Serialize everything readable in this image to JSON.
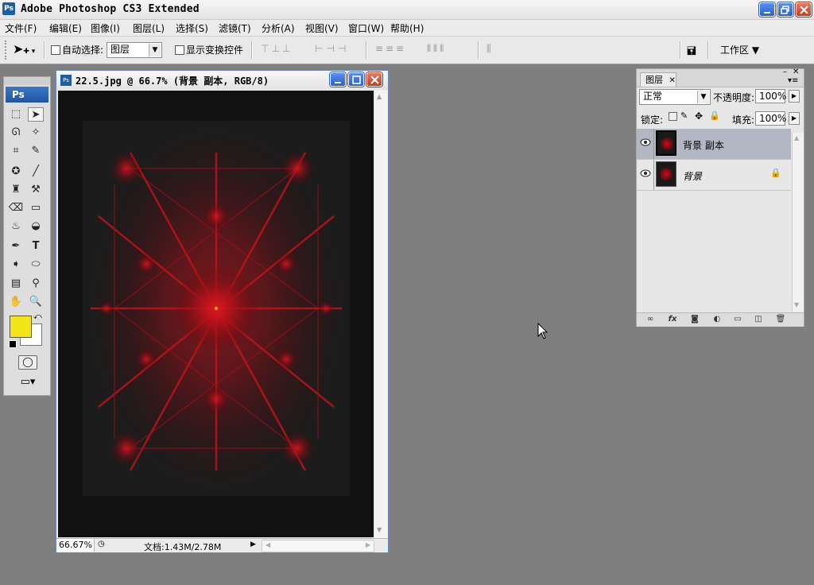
{
  "window": {
    "title": "Adobe Photoshop CS3 Extended",
    "app_badge": "Ps"
  },
  "menubar": [
    "文件(F)",
    "编辑(E)",
    "图像(I)",
    "图层(L)",
    "选择(S)",
    "滤镜(T)",
    "分析(A)",
    "视图(V)",
    "窗口(W)",
    "帮助(H)"
  ],
  "options": {
    "auto_select_label": "自动选择:",
    "auto_select_value": "图层",
    "show_transform_label": "显示变换控件",
    "workspace_label": "工作区 ▼"
  },
  "tools": {
    "badge": "Ps",
    "foreground_color": "#f2e51a",
    "background_color": "#ffffff"
  },
  "document": {
    "title": "22.5.jpg @ 66.7% (背景 副本, RGB/8)",
    "zoom": "66.67%",
    "doc_info": "文档:1.43M/2.78M"
  },
  "layers_panel": {
    "tab": "图层",
    "blend_mode": "正常",
    "opacity_label": "不透明度:",
    "opacity_value": "100%",
    "lock_label": "锁定:",
    "fill_label": "填充:",
    "fill_value": "100%",
    "layers": [
      {
        "name": "背景 副本",
        "selected": true,
        "locked": false
      },
      {
        "name": "背景",
        "selected": false,
        "locked": true
      }
    ],
    "footer_icons": [
      "link-icon",
      "fx-icon",
      "mask-icon",
      "adjustment-icon",
      "group-icon",
      "new-layer-icon",
      "trash-icon"
    ]
  }
}
